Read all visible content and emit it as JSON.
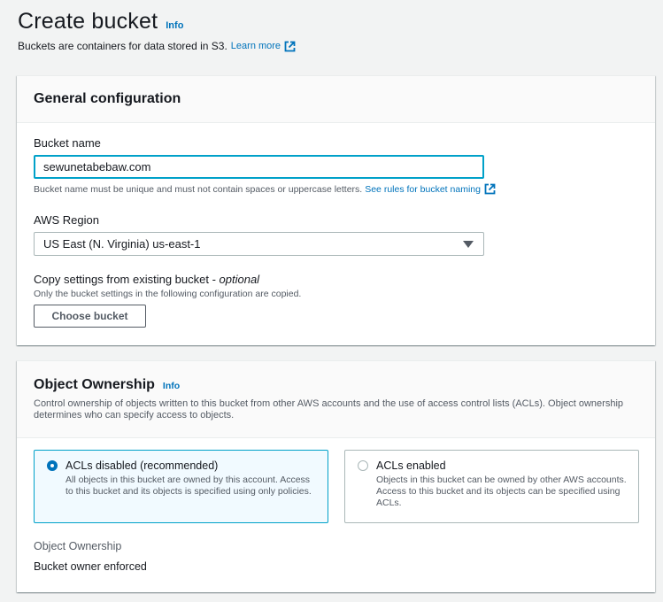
{
  "header": {
    "title": "Create bucket",
    "info": "Info",
    "subtitle": "Buckets are containers for data stored in S3.",
    "learn_more": "Learn more"
  },
  "general": {
    "title": "General configuration",
    "bucket_name_label": "Bucket name",
    "bucket_name_value": "sewunetabebaw.com",
    "bucket_name_constraint": "Bucket name must be unique and must not contain spaces or uppercase letters.",
    "bucket_name_rules_link": "See rules for bucket naming",
    "region_label": "AWS Region",
    "region_value": "US East (N. Virginia) us-east-1",
    "copy_label": "Copy settings from existing bucket - ",
    "copy_label_optional": "optional",
    "copy_desc": "Only the bucket settings in the following configuration are copied.",
    "choose_bucket": "Choose bucket"
  },
  "ownership": {
    "title": "Object Ownership",
    "info": "Info",
    "desc": "Control ownership of objects written to this bucket from other AWS accounts and the use of access control lists (ACLs). Object ownership determines who can specify access to objects.",
    "options": [
      {
        "label": "ACLs disabled (recommended)",
        "desc": "All objects in this bucket are owned by this account. Access to this bucket and its objects is specified using only policies.",
        "selected": true
      },
      {
        "label": "ACLs enabled",
        "desc": "Objects in this bucket can be owned by other AWS accounts. Access to this bucket and its objects can be specified using ACLs.",
        "selected": false
      }
    ],
    "kv_label": "Object Ownership",
    "kv_value": "Bucket owner enforced"
  },
  "colors": {
    "link": "#0073bb",
    "focus": "#00a1c9",
    "background": "#f2f3f3"
  },
  "icons": [
    "external-link-icon",
    "caret-down-icon",
    "radio-icon"
  ]
}
